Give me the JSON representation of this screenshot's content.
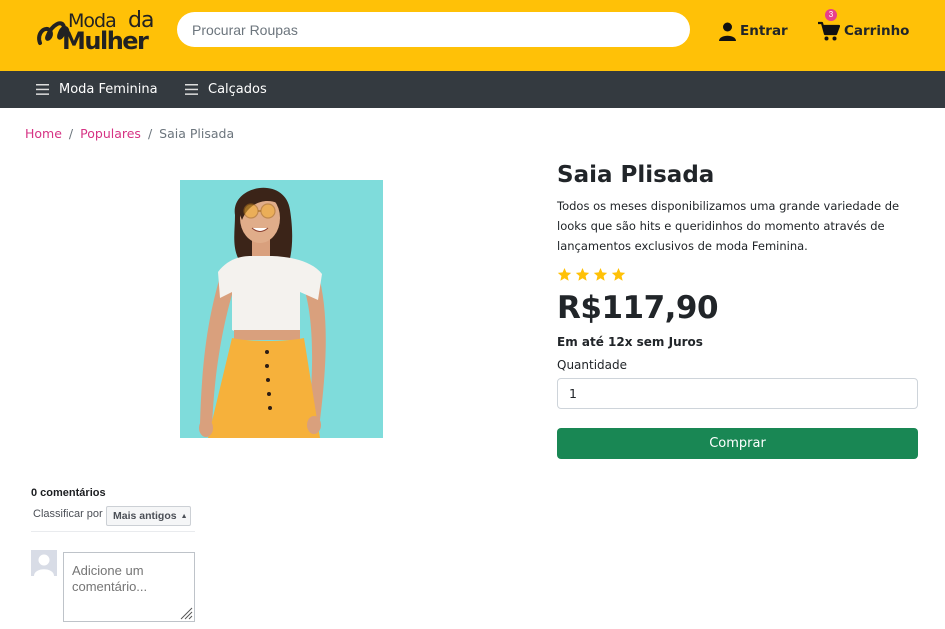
{
  "header": {
    "logo": {
      "line1": "Moda",
      "line2": "da",
      "line3": "Mulher"
    },
    "search_placeholder": "Procurar Roupas",
    "login_label": "Entrar",
    "cart_label": "Carrinho",
    "cart_count": "3"
  },
  "nav": {
    "items": [
      {
        "label": "Moda Feminina"
      },
      {
        "label": "Calçados"
      }
    ]
  },
  "breadcrumb": {
    "items": [
      {
        "label": "Home"
      },
      {
        "label": "Populares"
      }
    ],
    "separator": "/",
    "current": "Saia Plisada"
  },
  "product": {
    "title": "Saia Plisada",
    "description": "Todos os meses disponibilizamos uma grande variedade de looks que são hits e queridinhos do momento através de lançamentos exclusivos de moda Feminina.",
    "rating": 4,
    "rating_max": 4,
    "price": "R$117,90",
    "installments": "Em até 12x sem Juros",
    "quantity_label": "Quantidade",
    "quantity_value": "1",
    "buy_label": "Comprar"
  },
  "comments": {
    "count_label": "0 comentários",
    "sort_label": "Classificar por",
    "sort_value": "Mais antigos",
    "input_placeholder": "Adicione um comentário..."
  },
  "colors": {
    "topbar": "#ffc107",
    "navbar": "#343a40",
    "link": "#d63384",
    "buy_button": "#198754",
    "star": "#ffc107"
  }
}
